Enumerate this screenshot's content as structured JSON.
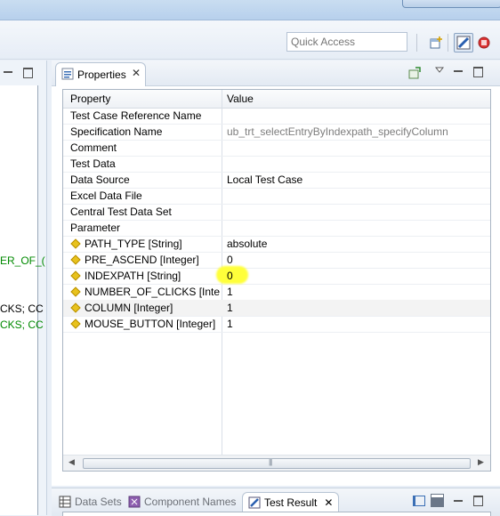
{
  "toolbar": {
    "quick_access_placeholder": "Quick Access",
    "icons": [
      "open-perspective-icon",
      "test-perspective-icon",
      "debug-perspective-icon"
    ]
  },
  "left_editor": {
    "lines": [
      {
        "text": "ER_OF_(",
        "color": "#008a00"
      },
      {
        "text": "CKS; CC",
        "color": "#000000"
      },
      {
        "text": "CKS; CC",
        "color": "#008a00"
      }
    ]
  },
  "properties": {
    "tab_label": "Properties",
    "columns": {
      "property": "Property",
      "value": "Value"
    },
    "rows": [
      {
        "name": "Test Case Reference Name",
        "value": "",
        "param": false
      },
      {
        "name": "Specification Name",
        "value": "ub_trt_selectEntryByIndexpath_specifyColumn",
        "param": false,
        "muted": true
      },
      {
        "name": "Comment",
        "value": "",
        "param": false
      },
      {
        "name": "Test Data",
        "value": "",
        "param": false
      },
      {
        "name": "Data Source",
        "value": "Local Test Case",
        "param": false
      },
      {
        "name": "Excel Data File",
        "value": "",
        "param": false
      },
      {
        "name": "Central Test Data Set",
        "value": "",
        "param": false
      },
      {
        "name": "Parameter",
        "value": "",
        "param": false
      },
      {
        "name": "PATH_TYPE [String]",
        "value": "absolute",
        "param": true
      },
      {
        "name": "PRE_ASCEND [Integer]",
        "value": "0",
        "param": true
      },
      {
        "name": "INDEXPATH [String]",
        "value": "0",
        "param": true,
        "highlight": true
      },
      {
        "name": "NUMBER_OF_CLICKS [Inte...",
        "value": "1",
        "param": true
      },
      {
        "name": "COLUMN [Integer]",
        "value": "1",
        "param": true,
        "selected": true
      },
      {
        "name": "MOUSE_BUTTON [Integer]",
        "value": "1",
        "param": true
      }
    ]
  },
  "bottom_tabs": [
    {
      "label": "Data Sets",
      "active": false
    },
    {
      "label": "Component Names",
      "active": false
    },
    {
      "label": "Test Result",
      "active": true
    }
  ],
  "colors": {
    "highlight": "#ffff3a",
    "param_marker": "#e8c21d"
  }
}
